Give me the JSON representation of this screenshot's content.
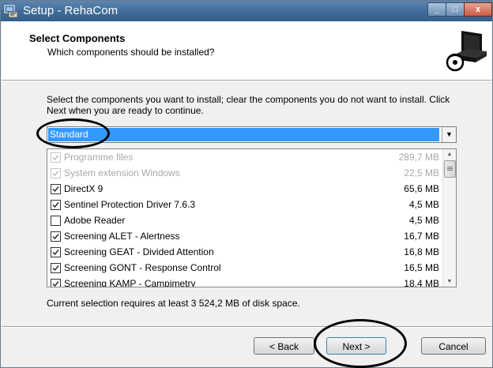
{
  "window": {
    "title": "Setup - RehaCom"
  },
  "header": {
    "title": "Select Components",
    "subtitle": "Which components should be installed?"
  },
  "instruction": "Select the components you want to install; clear the components you do not want to install. Click Next when you are ready to continue.",
  "install_type": {
    "selected": "Standard"
  },
  "components": [
    {
      "label": "Programme files",
      "size": "289,7 MB",
      "checked": true,
      "disabled": true
    },
    {
      "label": "System extension Windows",
      "size": "22,5 MB",
      "checked": true,
      "disabled": true
    },
    {
      "label": "DirectX 9",
      "size": "65,6 MB",
      "checked": true,
      "disabled": false
    },
    {
      "label": "Sentinel Protection Driver 7.6.3",
      "size": "4,5 MB",
      "checked": true,
      "disabled": false
    },
    {
      "label": "Adobe Reader",
      "size": "4,5 MB",
      "checked": false,
      "disabled": false
    },
    {
      "label": "Screening ALET - Alertness",
      "size": "16,7 MB",
      "checked": true,
      "disabled": false
    },
    {
      "label": "Screening GEAT - Divided Attention",
      "size": "16,8 MB",
      "checked": true,
      "disabled": false
    },
    {
      "label": "Screening GONT - Response Control",
      "size": "16,5 MB",
      "checked": true,
      "disabled": false
    },
    {
      "label": "Screening KAMP - Campimetry",
      "size": "18,4 MB",
      "checked": true,
      "disabled": false
    }
  ],
  "disk_requirement": "Current selection requires at least 3 524,2 MB of disk space.",
  "buttons": {
    "back": "< Back",
    "next": "Next >",
    "cancel": "Cancel"
  },
  "icons": {
    "app": "setup-icon",
    "header": "computer-install-icon"
  }
}
